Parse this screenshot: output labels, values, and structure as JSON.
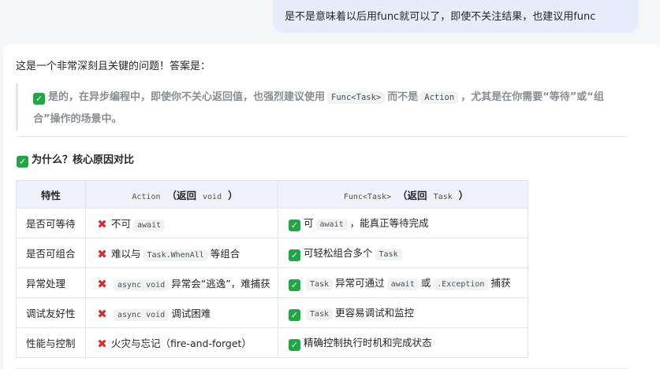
{
  "user_message": "是不是意味着以后用func就可以了，即使不关注结果，也建议用func",
  "intro": "这是一个非常深刻且关键的问题！答案是：",
  "quote": {
    "part1": "是的，在异步编程中，即使你不关心返回值，也强烈建议使用",
    "code1": "Func<Task>",
    "part2": "而不是",
    "code2": "Action",
    "part3": "，尤其是在你需要“等待”或“组合”操作的场景中。"
  },
  "section_title": "为什么？核心原因对比",
  "table": {
    "headers": {
      "h0": "特性",
      "h1_code": "Action",
      "h1_text": "（返回",
      "h1_code2": "void",
      "h1_close": "）",
      "h2_code": "Func<Task>",
      "h2_text": "（返回",
      "h2_code2": "Task",
      "h2_close": "）"
    },
    "rows": [
      {
        "feature": "是否可等待",
        "action_text_a": "不可",
        "action_code": "await",
        "action_text_b": "",
        "func_text_a": "可",
        "func_code": "await",
        "func_text_b": "，能真正等待完成"
      },
      {
        "feature": "是否可组合",
        "action_text_a": "难以与",
        "action_code": "Task.WhenAll",
        "action_text_b": "等组合",
        "func_text_a": "可轻松组合多个",
        "func_code": "Task",
        "func_text_b": ""
      },
      {
        "feature": "异常处理",
        "action_text_a": "",
        "action_code": "async void",
        "action_text_b": "异常会“逃逸”，难捕获",
        "func_text_a": "",
        "func_code": "Task",
        "func_text_b": "异常可通过",
        "func_code2": "await",
        "func_text_c": "或",
        "func_code3": ".Exception",
        "func_text_d": "捕获"
      },
      {
        "feature": "调试友好性",
        "action_text_a": "",
        "action_code": "async void",
        "action_text_b": "调试困难",
        "func_text_a": "",
        "func_code": "Task",
        "func_text_b": "更容易调试和监控"
      },
      {
        "feature": "性能与控制",
        "action_text_a": "火灾与忘记（fire-and-forget）",
        "func_text_a": "精确控制执行时机和完成状态"
      }
    ]
  },
  "icons": {
    "check": "check-mark-icon",
    "cross": "cross-mark-icon"
  },
  "colors": {
    "check_bg": "#22a447",
    "cross": "#d92c2c",
    "user_bubble": "#e8ebfa",
    "table_header": "#eef0fc"
  }
}
